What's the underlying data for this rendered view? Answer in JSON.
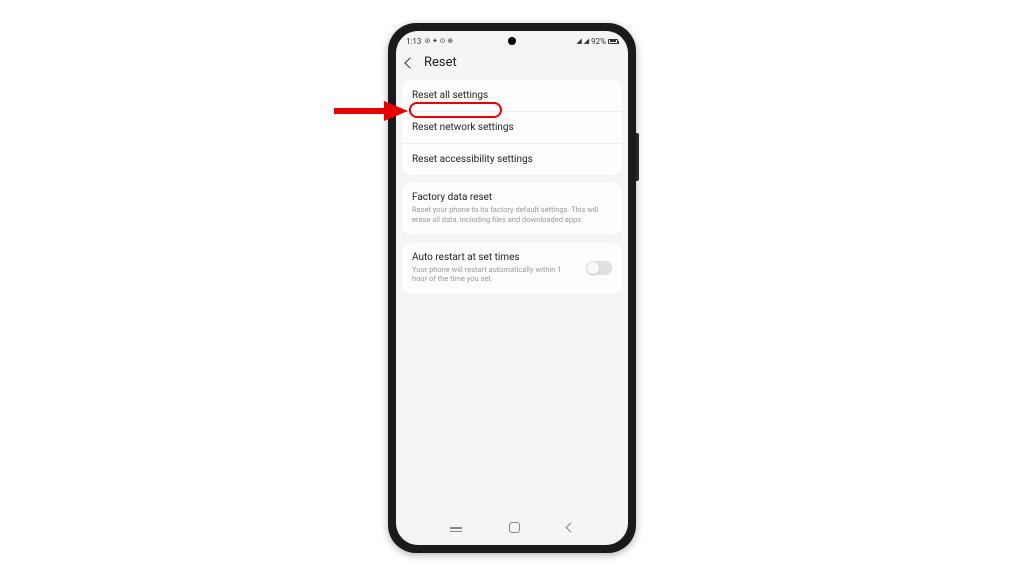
{
  "status_bar": {
    "time": "1:13",
    "battery_percent": "92%"
  },
  "header": {
    "title": "Reset"
  },
  "groups": [
    {
      "items": [
        {
          "label": "Reset all settings",
          "highlighted": true
        },
        {
          "label": "Reset network settings"
        },
        {
          "label": "Reset accessibility settings"
        }
      ]
    },
    {
      "items": [
        {
          "label": "Factory data reset",
          "description": "Reset your phone to its factory default settings. This will erase all data, including files and downloaded apps."
        }
      ]
    },
    {
      "items": [
        {
          "label": "Auto restart at set times",
          "description": "Your phone will restart automatically within 1 hour of the time you set.",
          "has_toggle": true,
          "toggle_on": false
        }
      ]
    }
  ],
  "annotation": {
    "arrow_color": "#e60000"
  }
}
